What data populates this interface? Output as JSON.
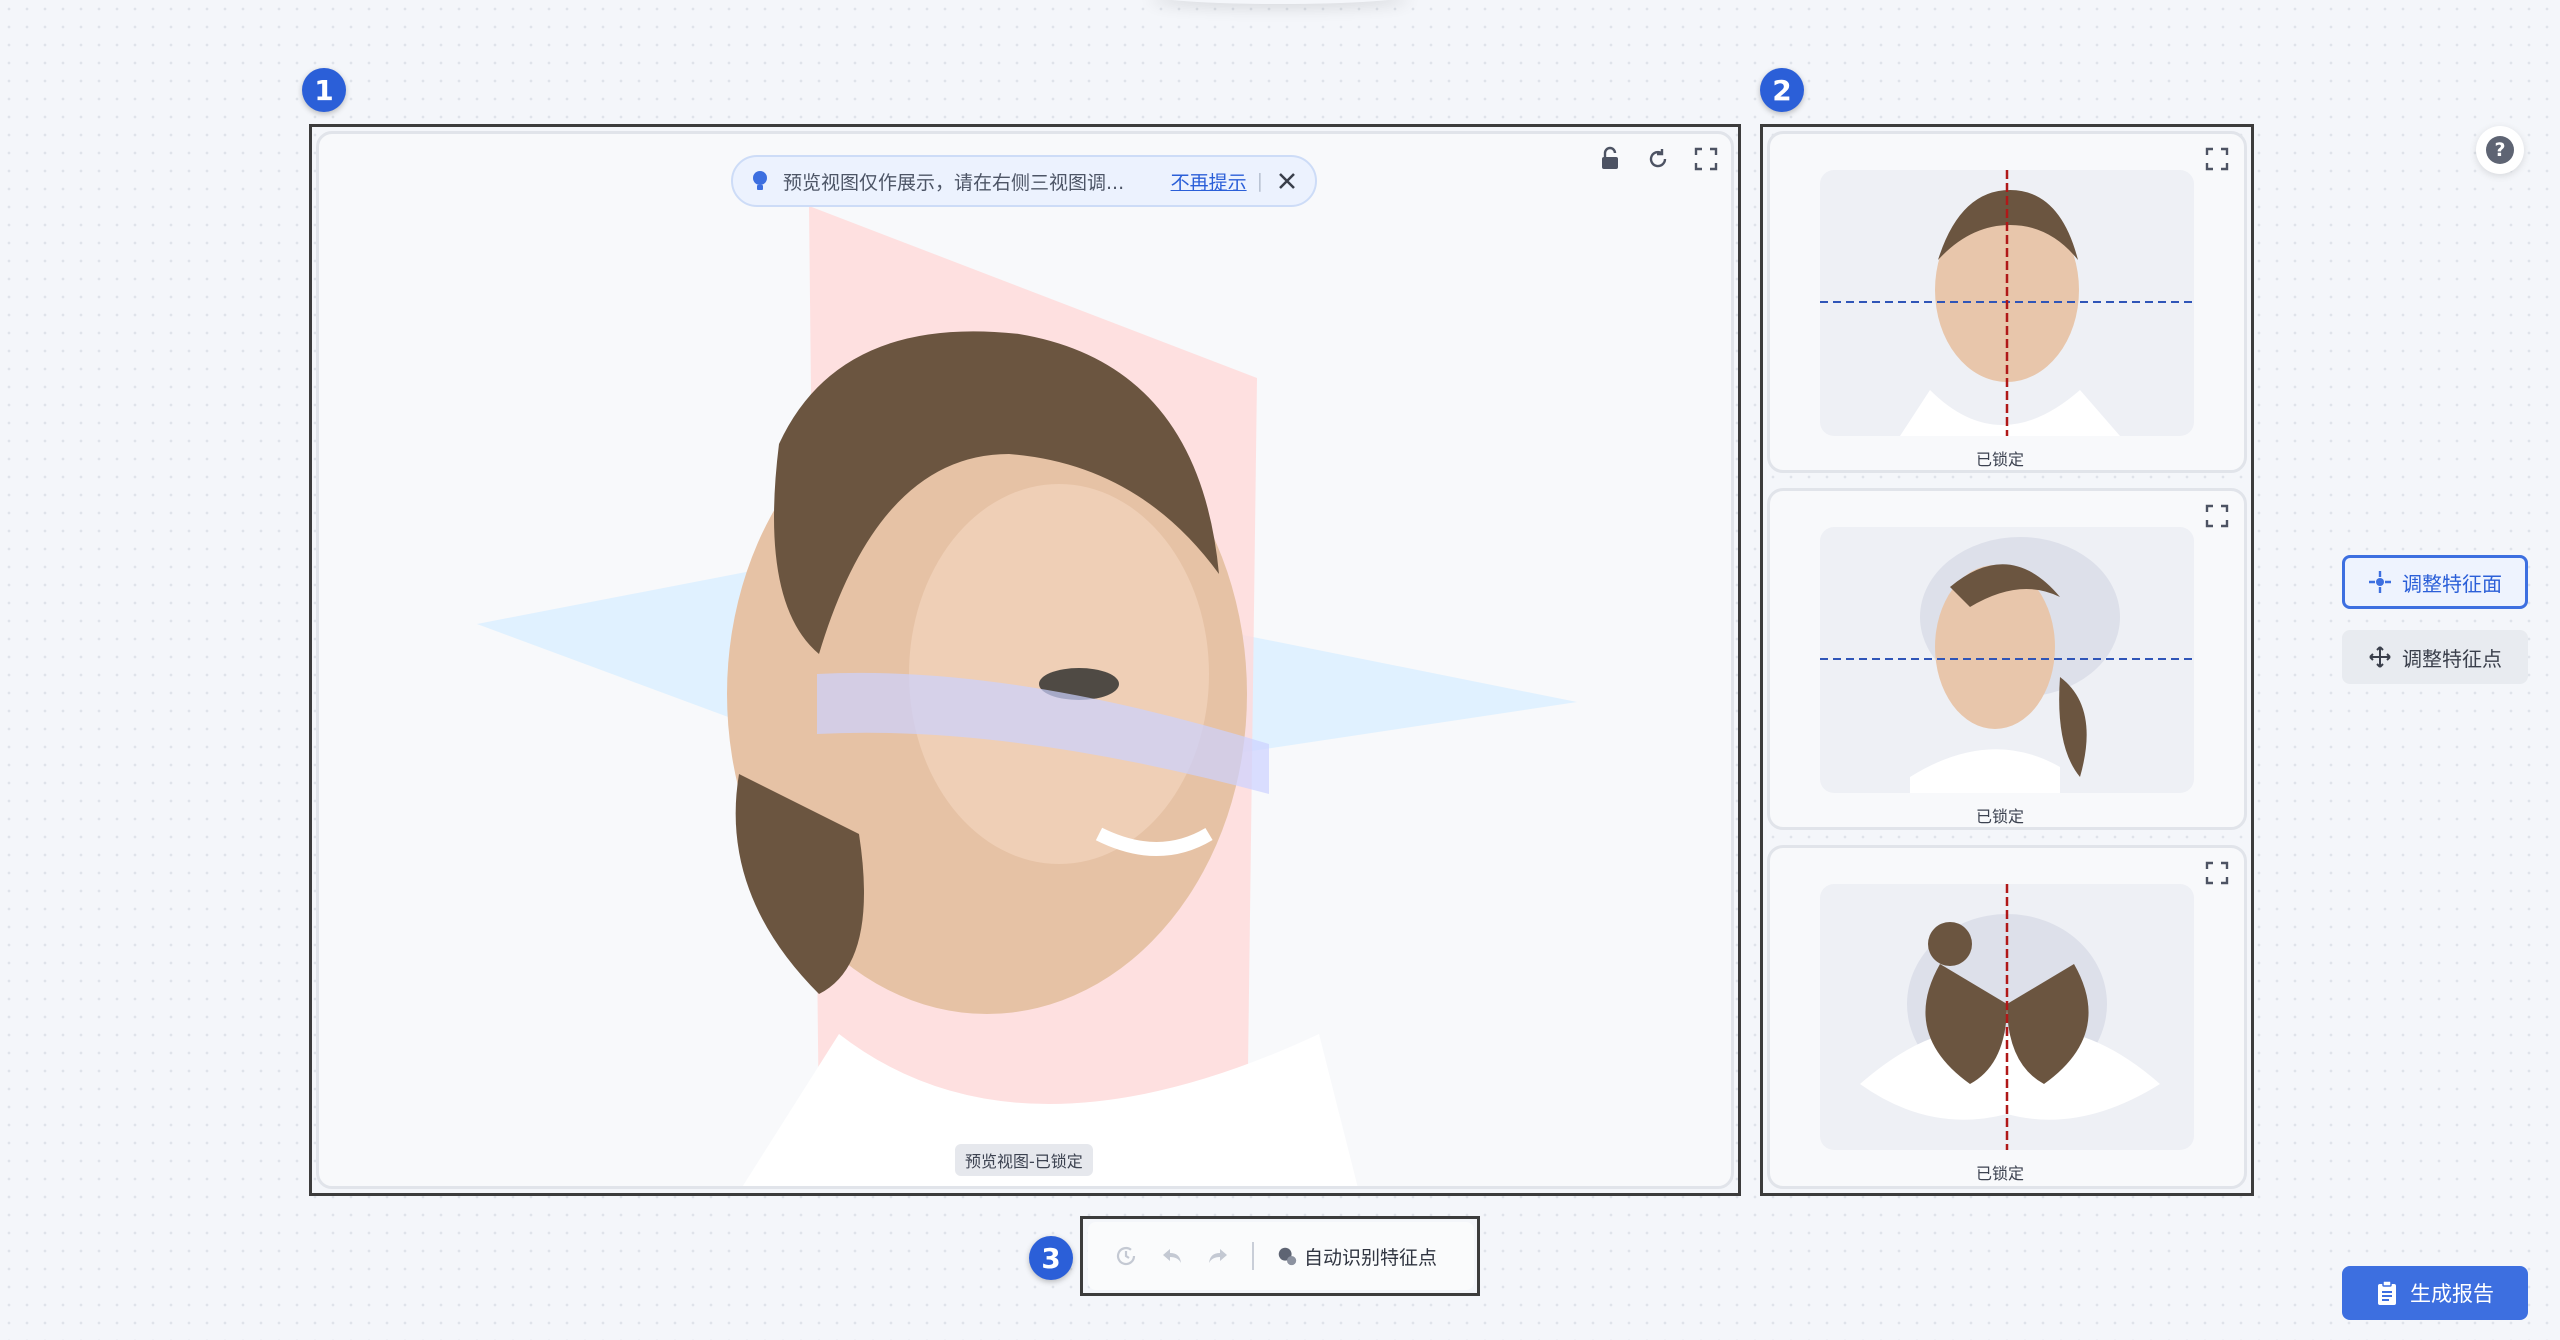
{
  "badges": {
    "main": "1",
    "views": "2",
    "toolbar": "3"
  },
  "preview": {
    "tip_message": "预览视图仅作展示，请在右侧三视图调...",
    "tip_link": "不再提示",
    "tip_separator": "|",
    "caption": "预览视图-已锁定"
  },
  "views": [
    {
      "name": "front",
      "caption": "已锁定"
    },
    {
      "name": "side",
      "caption": "已锁定"
    },
    {
      "name": "top",
      "caption": "已锁定"
    }
  ],
  "controls": {
    "adjust_plane": "调整特征面",
    "adjust_point": "调整特征点",
    "help": "?",
    "generate_report": "生成报告"
  },
  "toolbar": {
    "auto_detect": "自动识别特征点"
  },
  "colors": {
    "accent": "#3d6fe0",
    "badge": "#2b5fd8",
    "midline": "#b01818",
    "horizontal_line": "#2f55b8"
  },
  "icons": [
    "bulb-icon",
    "close-icon",
    "lock-icon",
    "reset-icon",
    "expand-icon",
    "crosshair-icon",
    "move-icon",
    "report-icon",
    "history-icon",
    "undo-icon",
    "redo-icon",
    "face-scan-icon"
  ]
}
